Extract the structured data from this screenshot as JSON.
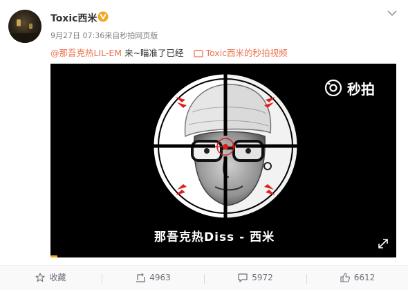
{
  "post": {
    "username": "Toxic西米",
    "date": "9月27日 07:36",
    "source": "来自秒拍网页版",
    "mention": "@那吾克热LIL-EM",
    "text": " 来~瞄准了已经",
    "video_link": "Toxic西米的秒拍视频"
  },
  "video": {
    "brand": "秒拍",
    "caption": "那吾克热Diss - 西米",
    "progress": 0.02
  },
  "actions": {
    "favorite": "收藏",
    "repost_count": "4963",
    "comment_count": "5972",
    "like_count": "6612"
  },
  "colors": {
    "accent": "#eb7350",
    "verified": "#f5a623",
    "scope_red": "#e0201c"
  },
  "icons": [
    "avatar",
    "verified-badge-icon",
    "chevron-down-icon",
    "video-link-icon",
    "miaopai-logo-icon",
    "fullscreen-icon",
    "star-icon",
    "repost-icon",
    "comment-icon",
    "like-icon"
  ]
}
